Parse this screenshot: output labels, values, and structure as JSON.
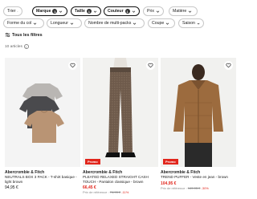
{
  "filters_row1": [
    {
      "label": "Trier",
      "active": false,
      "badge": ""
    },
    {
      "label": "Marque",
      "active": true,
      "badge": "1"
    },
    {
      "label": "Taille",
      "active": true,
      "badge": "1"
    },
    {
      "label": "Couleur",
      "active": true,
      "badge": "1"
    },
    {
      "label": "Prix",
      "active": false,
      "badge": ""
    },
    {
      "label": "Matière",
      "active": false,
      "badge": ""
    }
  ],
  "filters_row2": [
    {
      "label": "Forme du col"
    },
    {
      "label": "Longueur"
    },
    {
      "label": "Nombre de multi-packs"
    },
    {
      "label": "Coupe"
    },
    {
      "label": "Saison"
    }
  ],
  "all_filters_label": "Tous les filtres",
  "results_count": "10 articles",
  "products": [
    {
      "brand": "Abercrombie & Fitch",
      "name": "NEUTRALS BOX 3 PACK - T-shirt basique - light brown",
      "price": "94,95 €",
      "promo": "",
      "ref_label": "",
      "ref_price": "",
      "discount": ""
    },
    {
      "brand": "Abercrombie & Fitch",
      "name": "PLEATED RELAXED STRAIGHT CASH TOUCH - Pantalon classique - brown",
      "price": "66,45 €",
      "promo": "Promo",
      "ref_label": "Prix de référence :",
      "ref_price": "74,95 €",
      "discount": "-11%"
    },
    {
      "brand": "Abercrombie & Fitch",
      "name": "TREND PUFFER - Veste en jean - brown",
      "price": "104,95 €",
      "promo": "Promo",
      "ref_label": "Prix de référence :",
      "ref_price": "149,95 €",
      "discount": "-30%"
    }
  ]
}
